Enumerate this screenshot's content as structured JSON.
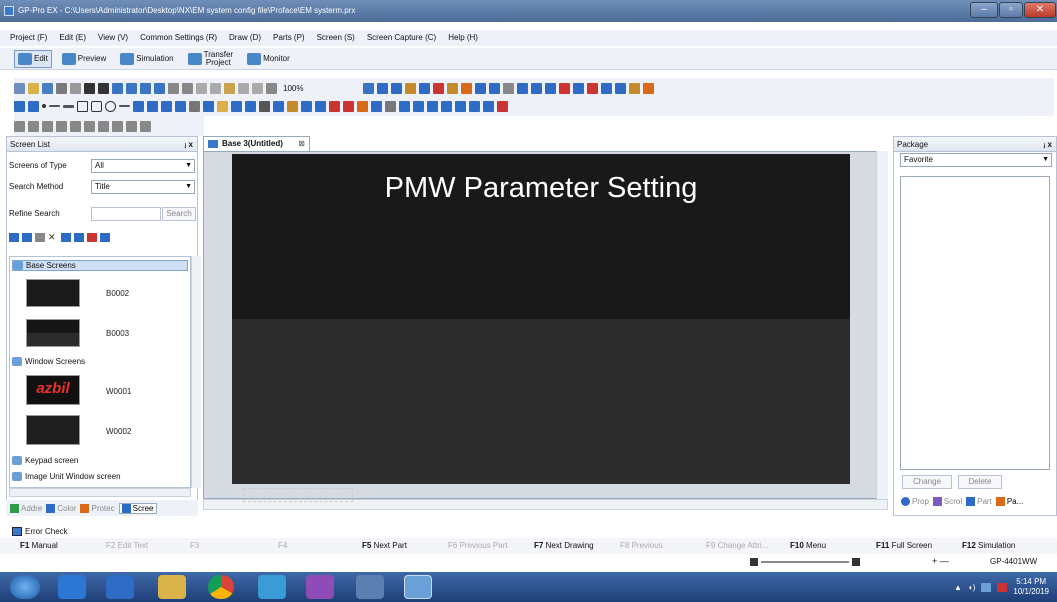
{
  "window": {
    "title": "GP-Pro EX - C:\\Users\\Administrator\\Desktop\\NX\\EM system config file\\Proface\\EM systerm.prx",
    "controls": [
      "–",
      "▫",
      "✕"
    ]
  },
  "menu": [
    "Project (F)",
    "Edit (E)",
    "View (V)",
    "Common Settings (R)",
    "Draw (D)",
    "Parts (P)",
    "Screen (S)",
    "Screen Capture (C)",
    "Help (H)"
  ],
  "modes": {
    "edit": "Edit",
    "preview": "Preview",
    "simulation": "Simulation",
    "transfer_line1": "Transfer",
    "transfer_line2": "Project",
    "monitor": "Monitor"
  },
  "toolbar": {
    "zoom": "100%"
  },
  "screen_list": {
    "title": "Screen List",
    "pin": "ⱼ x",
    "type_label": "Screens of Type",
    "type_value": "All",
    "method_label": "Search Method",
    "method_value": "Title",
    "refine_label": "Refine Search",
    "search_button": "Search",
    "categories": {
      "base": "Base Screens",
      "window": "Window Screens",
      "keypad": "Keypad screen",
      "image": "Image Unit Window screen"
    },
    "items": [
      {
        "id": "B0002"
      },
      {
        "id": "B0003"
      },
      {
        "id": "W0001",
        "logo": "azbil"
      },
      {
        "id": "W0002"
      }
    ],
    "tabs": [
      "Addre",
      "Color",
      "Protec",
      "Scree"
    ]
  },
  "editor": {
    "tab": "Base 3(Untitled)",
    "canvas_title": "PMW Parameter Setting"
  },
  "package": {
    "title": "Package",
    "pin": "ⱼ x",
    "dropdown": "Favorite",
    "change_button": "Change",
    "delete_button": "Delete",
    "tabs": [
      "Prop",
      "Scrol",
      "Part",
      "Pa..."
    ]
  },
  "status": {
    "error_check": "Error Check",
    "fkeys": [
      {
        "key": "F1",
        "label": "Manual",
        "enabled": true
      },
      {
        "key": "F2",
        "label": "Edit Text",
        "enabled": false
      },
      {
        "key": "F3",
        "label": "",
        "enabled": false
      },
      {
        "key": "F4",
        "label": "",
        "enabled": false
      },
      {
        "key": "F5",
        "label": "Next Part",
        "enabled": true
      },
      {
        "key": "F6",
        "label": "Previous Part",
        "enabled": false
      },
      {
        "key": "F7",
        "label": "Next Drawing",
        "enabled": true
      },
      {
        "key": "F8",
        "label": "Previous",
        "enabled": false
      },
      {
        "key": "F9",
        "label": "Change Attri...",
        "enabled": false
      },
      {
        "key": "F10",
        "label": "Menu",
        "enabled": true
      },
      {
        "key": "F11",
        "label": "Full Screen",
        "enabled": true
      },
      {
        "key": "F12",
        "label": "Simulation",
        "enabled": true
      }
    ],
    "zoom_plus_minus": "+ —",
    "model": "GP-4401WW"
  },
  "taskbar": {
    "time": "5:14 PM",
    "date": "10/1/2019"
  },
  "colors": {
    "titlebar": "#5577a6",
    "canvas_top": "#191919",
    "canvas_bottom": "#2c2c2c",
    "taskbar": "#2b4f8c"
  }
}
